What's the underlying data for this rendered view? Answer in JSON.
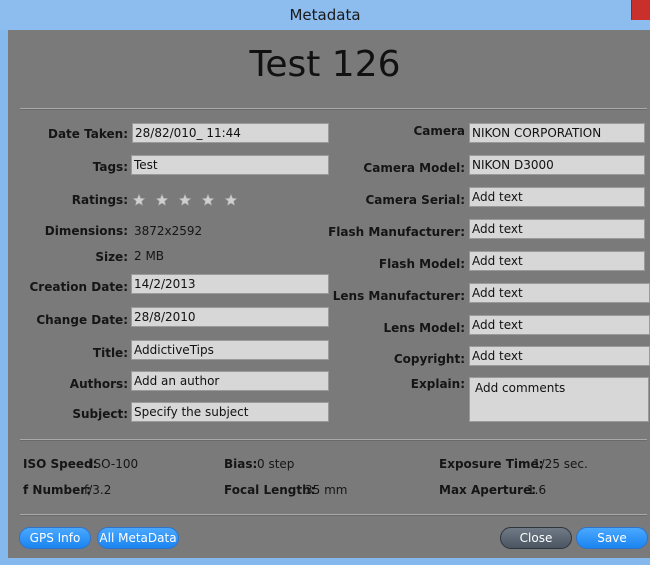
{
  "window": {
    "title": "Metadata"
  },
  "heading": "Test 126",
  "left_fields": {
    "date_taken": {
      "label": "Date Taken:",
      "value": "28/82/010_ 11:44"
    },
    "tags": {
      "label": "Tags:",
      "value": "Test"
    },
    "ratings": {
      "label": "Ratings:",
      "stars": 5,
      "filled": 0
    },
    "dimensions": {
      "label": "Dimensions:",
      "value": "3872x2592"
    },
    "size": {
      "label": "Size:",
      "value": "2 MB"
    },
    "creation_date": {
      "label": "Creation Date:",
      "value": "14/2/2013"
    },
    "change_date": {
      "label": "Change Date:",
      "value": "28/8/2010"
    },
    "title": {
      "label": "Title:",
      "value": "AddictiveTips"
    },
    "authors": {
      "label": "Authors:",
      "value": "Add an author"
    },
    "subject": {
      "label": "Subject:",
      "value": "Specify the subject"
    }
  },
  "right_fields": {
    "camera": {
      "label": "Camera",
      "value": "NIKON CORPORATION"
    },
    "camera_model": {
      "label": "Camera Model:",
      "value": "NIKON D3000"
    },
    "camera_serial": {
      "label": "Camera Serial:",
      "value": "Add text"
    },
    "flash_manufacturer": {
      "label": "Flash Manufacturer:",
      "value": "Add text"
    },
    "flash_model": {
      "label": "Flash Model:",
      "value": "Add text"
    },
    "lens_manufacturer": {
      "label": "Lens Manufacturer:",
      "value": "Add text"
    },
    "lens_model": {
      "label": "Lens Model:",
      "value": "Add text"
    },
    "copyright": {
      "label": "Copyright:",
      "value": "Add text"
    },
    "explain": {
      "label": "Explain:",
      "value": "Add comments"
    }
  },
  "exif": {
    "iso_speed": {
      "label": "ISO Speed:",
      "value": "ISO-100"
    },
    "bias": {
      "label": "Bias:",
      "value": "0 step"
    },
    "exposure_time": {
      "label": "Exposure Time:",
      "value": "1/25 sec."
    },
    "f_number": {
      "label": "f Number:",
      "value": "f/3.2"
    },
    "focal_length": {
      "label": "Focal Length:",
      "value": "35 mm"
    },
    "max_aperture": {
      "label": "Max Aperture:",
      "value": "1.6"
    }
  },
  "buttons": {
    "gps_info": "GPS Info",
    "all_metadata": "All MetaData",
    "close": "Close",
    "save": "Save"
  },
  "colors": {
    "titlebar": "#8dbcee",
    "panel": "#7a7a7a",
    "field": "#d7d7d7",
    "button_blue": "#1a84f0",
    "button_gray": "#4b5561",
    "close_x": "#c9302c"
  },
  "icons": {
    "star": "star-outline-icon",
    "window_close": "window-close-icon"
  }
}
